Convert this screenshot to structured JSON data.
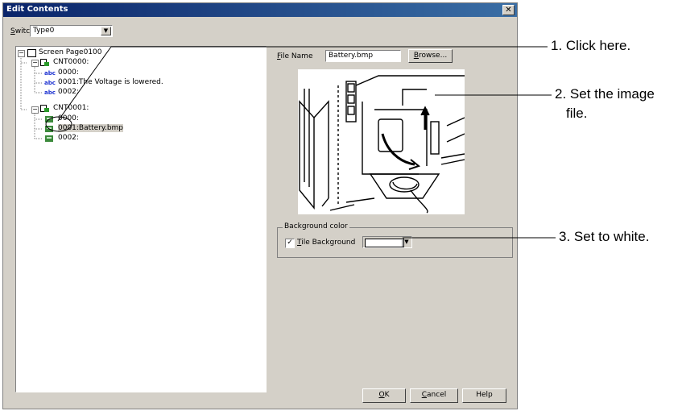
{
  "window": {
    "title": "Edit Contents",
    "close_glyph": "✕"
  },
  "switch": {
    "label_u": "S",
    "label_rest": "witch",
    "value": "Type0"
  },
  "tree": {
    "root": "Screen Page0100",
    "cnt0": "CNT0000:",
    "cnt0_items": [
      "0000:",
      "0001:The Voltage is lowered.",
      "0002:"
    ],
    "cnt1": "CNT0001:",
    "cnt1_items": [
      "0000:",
      "0001:Battery.bmp",
      "0002:"
    ],
    "abc_icon_text": "abc"
  },
  "file": {
    "label_u": "F",
    "label_rest": "ile Name",
    "value": "Battery.bmp",
    "browse_u": "B",
    "browse_rest": "rowse..."
  },
  "background": {
    "group_label": "Background color",
    "checkbox_u": "T",
    "checkbox_rest": "ile Background",
    "checked": true,
    "check_glyph": "✓",
    "color": "#ffffff"
  },
  "buttons": {
    "ok_u": "O",
    "ok_rest": "K",
    "cancel_u": "C",
    "cancel_rest": "ancel",
    "help": "Help"
  },
  "annotations": [
    "1. Click here.",
    "2. Set the image",
    "file.",
    "3. Set to white."
  ]
}
